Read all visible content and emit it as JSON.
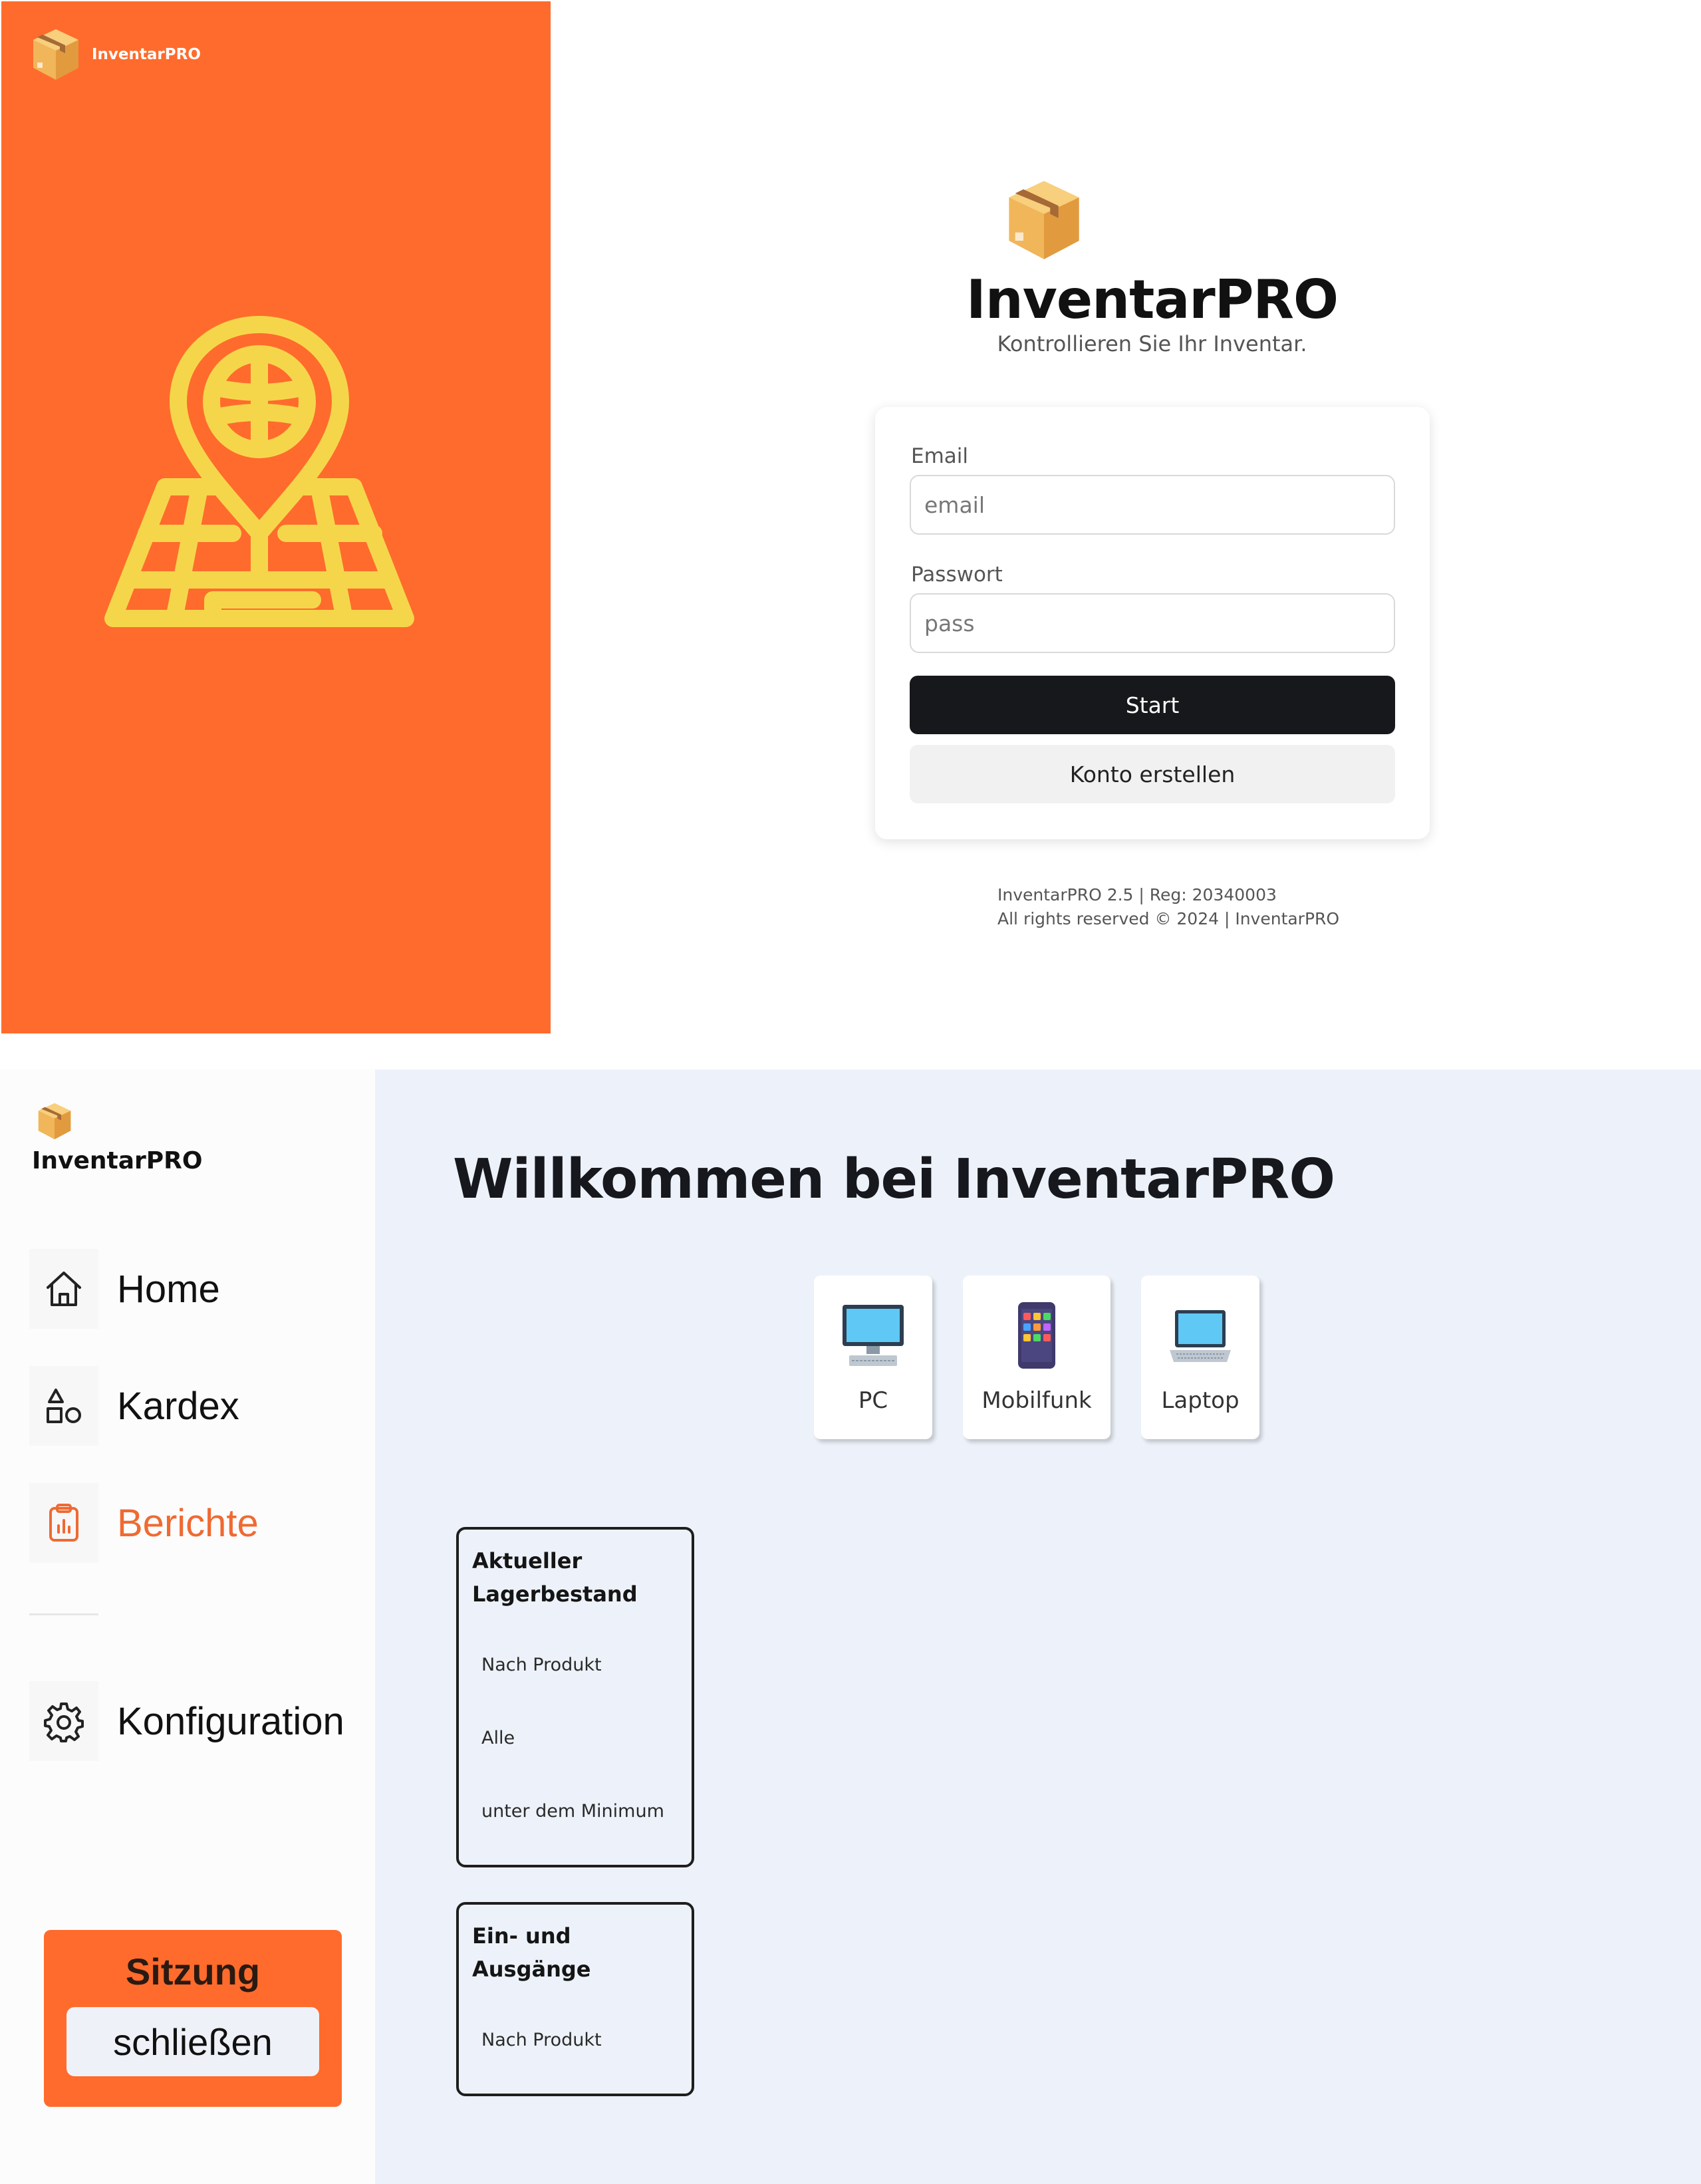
{
  "app": {
    "name": "InventarPRO",
    "accent_color": "#ff6b2c",
    "accent_text_color": "#ef6a32"
  },
  "login": {
    "brand_label": "InventarPRO",
    "title": "InventarPRO",
    "subtitle": "Kontrollieren Sie Ihr Inventar.",
    "email_label": "Email",
    "email_placeholder": "email",
    "password_label": "Passwort",
    "password_placeholder": "pass",
    "start_label": "Start",
    "create_account_label": "Konto erstellen",
    "footer_version": "InventarPRO 2.5 | Reg: 20340003",
    "footer_rights": "All rights reserved © 2024 | InventarPRO",
    "hero_icon": "map-pin-globe-icon",
    "hero_icon_color": "#f5d64b"
  },
  "sidebar": {
    "brand_label": "InventarPRO",
    "items": [
      {
        "label": "Home",
        "icon": "home-icon",
        "active": false
      },
      {
        "label": "Kardex",
        "icon": "shapes-icon",
        "active": false
      },
      {
        "label": "Berichte",
        "icon": "clipboard-report-icon",
        "active": true
      },
      {
        "label": "Konfiguration",
        "icon": "gear-icon",
        "active": false
      }
    ],
    "logout": {
      "title": "Sitzung",
      "button_label": "schließen"
    }
  },
  "main": {
    "welcome_title": "Willkommen bei InventarPRO",
    "device_categories": [
      {
        "label": "PC",
        "icon": "desktop-computer-icon"
      },
      {
        "label": "Mobilfunk",
        "icon": "smartphone-icon"
      },
      {
        "label": "Laptop",
        "icon": "laptop-icon"
      }
    ],
    "reports": [
      {
        "title": "Aktueller Lagerbestand",
        "links": [
          "Nach Produkt",
          "Alle",
          "unter dem Minimum"
        ]
      },
      {
        "title": "Ein- und Ausgänge",
        "links": [
          "Nach Produkt"
        ]
      }
    ]
  }
}
